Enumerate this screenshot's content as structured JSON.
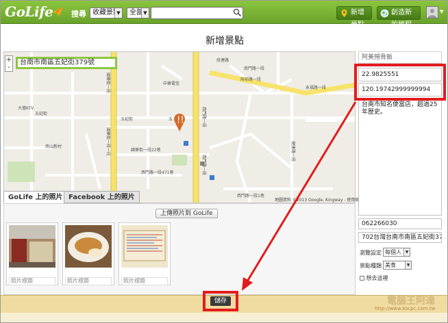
{
  "topbar": {
    "logo": "GoLife",
    "search_label": "搜尋",
    "category_select": "收藏景點",
    "region_select": "全部",
    "add_place_button": "新增景點",
    "create_trip_button": "創造新的旅程"
  },
  "page": {
    "title": "新增景點"
  },
  "map": {
    "address": "台南市南區五妃街379號",
    "zoom_in": "+",
    "zoom_out": "-",
    "credit": "地圖資料 ©2013 Google, Kingway - 使用條款",
    "street_labels": [
      "五妃街",
      "五妃街",
      "五",
      "西門路一段",
      "國華街一段",
      "西門路一段",
      "國華街一段一段",
      "永福路一段",
      "南門路一段",
      "府前路一段",
      "健康路一段",
      "國華街一段22巷",
      "西門路一段471巷",
      "西門路一段1巷",
      "府連路",
      "大億KTV",
      "南山新村",
      "中華電信"
    ]
  },
  "tabs": [
    {
      "label": "GoLife 上的照片",
      "active": true
    },
    {
      "label": "Facebook 上的照片",
      "active": false
    }
  ],
  "photos": {
    "upload_label": "上傳照片到 GoLife",
    "items": [
      {
        "caption": "照片標題",
        "color": "#8a6a4a"
      },
      {
        "caption": "照片標題",
        "color": "#c9a978"
      },
      {
        "caption": "照片標題",
        "color": "#e6dcc2"
      }
    ]
  },
  "details": {
    "name": "阿美撈骨飯",
    "latitude": "22.9825551",
    "longitude": "120.19742999999994",
    "description": "台南市知名便當店，超過25年歷史。",
    "phone": "062266030",
    "address": "702台灣台南市南區五妃街37",
    "visibility_label": "瀏覽設定",
    "visibility_value": "每個人",
    "category_label": "景點種類",
    "category_value": "美食",
    "visited_label": "想去這裡"
  },
  "footer": {
    "save_button": "儲存",
    "watermark": "http://www.kocpc.com.tw",
    "watermark_big": "電腦王阿達"
  },
  "colors": {
    "brand_green": "#7ab432",
    "highlight_red": "#e21c1c",
    "footer_tan": "#f0dba0"
  }
}
